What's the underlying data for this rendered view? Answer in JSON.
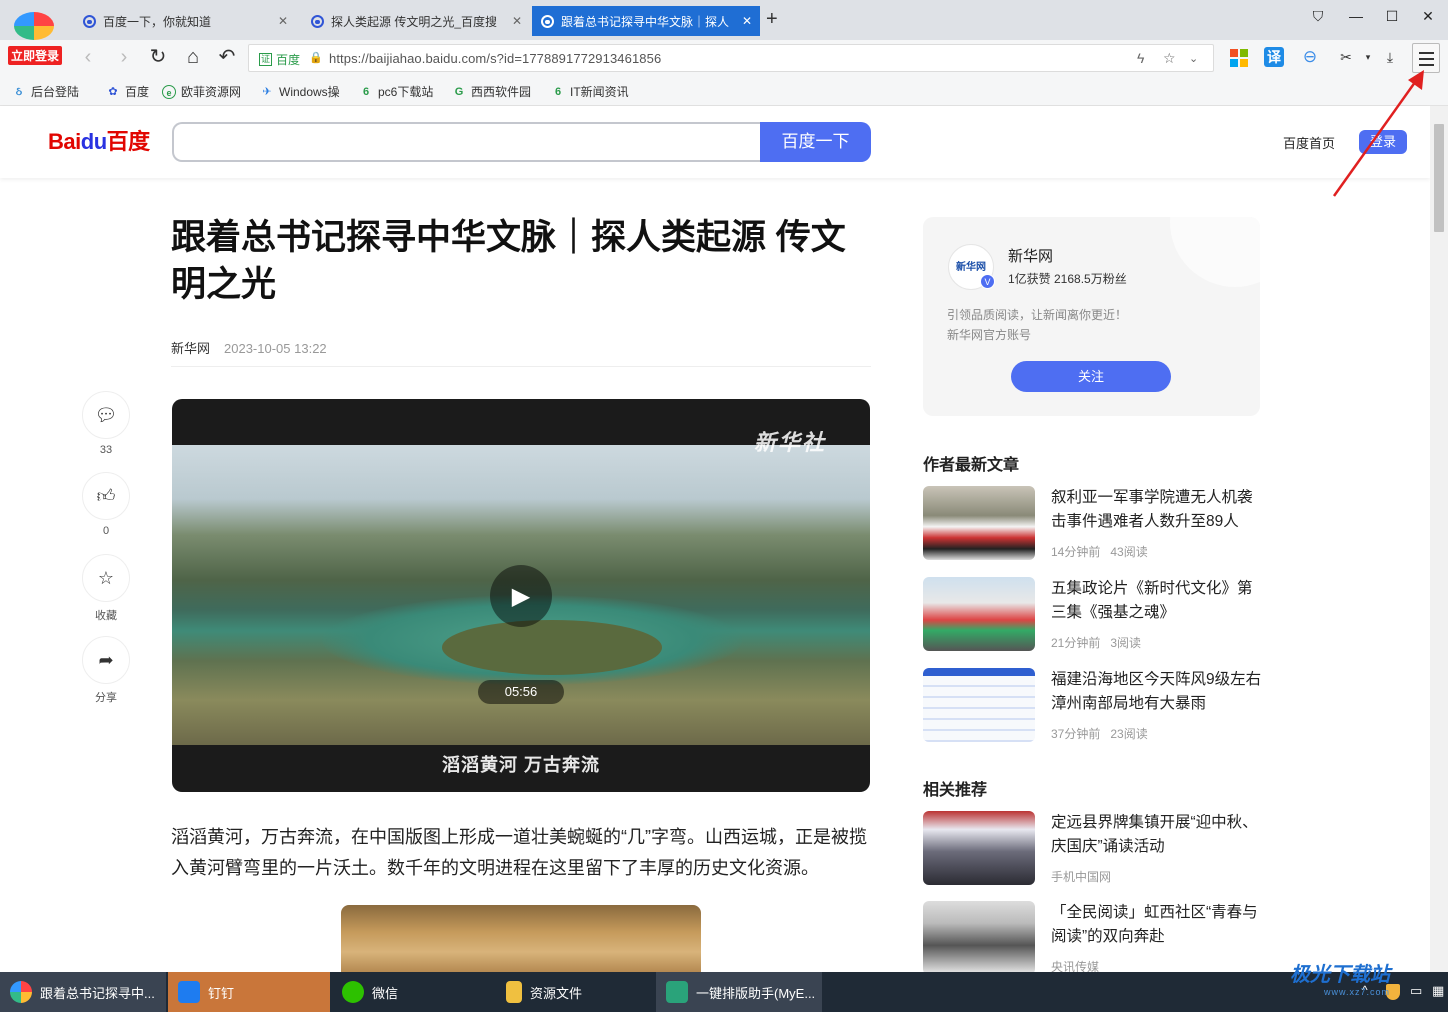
{
  "browser": {
    "profile_badge": "立即登录",
    "tabs": [
      {
        "title": "百度一下，你就知道",
        "active": false
      },
      {
        "title": "探人类起源 传文明之光_百度搜",
        "active": false
      },
      {
        "title": "跟着总书记探寻中华文脉｜探人",
        "active": true
      }
    ],
    "new_tab": "+",
    "address": {
      "secure_label": "百度",
      "url": "https://baijiahao.baidu.com/s?id=1778891772913461856"
    },
    "translate_label": "译",
    "bookmarks": [
      "后台登陆",
      "百度",
      "欧菲资源网",
      "Windows操",
      "pc6下载站",
      "西西软件园",
      "IT新闻资讯"
    ]
  },
  "page_header": {
    "logo_text_1": "Bai",
    "logo_text_2": "du",
    "logo_text_3": "百度",
    "search_button": "百度一下",
    "home_link": "百度首页",
    "login_button": "登录"
  },
  "article": {
    "title": "跟着总书记探寻中华文脉｜探人类起源 传文明之光",
    "source": "新华网",
    "date": "2023-10-05 13:22",
    "side_actions": [
      {
        "icon": "comment-icon",
        "label": "33"
      },
      {
        "icon": "thumbs-up-icon",
        "label": "0"
      },
      {
        "icon": "star-icon",
        "label": "收藏"
      },
      {
        "icon": "share-icon",
        "label": "分享"
      }
    ],
    "video": {
      "watermark": "新华社",
      "duration": "05:56",
      "caption": "滔滔黄河 万古奔流"
    },
    "paragraph": "滔滔黄河，万古奔流，在中国版图上形成一道壮美蜿蜒的“几”字弯。山西运城，正是被揽入黄河臂弯里的一片沃土。数千年的文明进程在这里留下了丰厚的历史文化资源。"
  },
  "author_card": {
    "name": "新华网",
    "stats": "1亿获赞 2168.5万粉丝",
    "desc_1": "引领品质阅读，让新闻离你更近！",
    "desc_2": "新华网官方账号",
    "follow": "关注",
    "avatar_text": "新华网"
  },
  "latest": {
    "heading": "作者最新文章",
    "items": [
      {
        "title": "叙利亚一军事学院遭无人机袭击事件遇难者人数升至89人",
        "time": "14分钟前",
        "reads": "43阅读"
      },
      {
        "title": "五集政论片《新时代文化》第三集《强基之魂》",
        "time": "21分钟前",
        "reads": "3阅读"
      },
      {
        "title": "福建沿海地区今天阵风9级左右 漳州南部局地有大暴雨",
        "time": "37分钟前",
        "reads": "23阅读"
      }
    ]
  },
  "related": {
    "heading": "相关推荐",
    "items": [
      {
        "title": "定远县界牌集镇开展“迎中秋、庆国庆”诵读活动",
        "source": "手机中国网"
      },
      {
        "title": "「全民阅读」虹西社区“青春与阅读”的双向奔赴",
        "source": "央讯传媒"
      }
    ]
  },
  "taskbar": {
    "items": [
      "跟着总书记探寻中...",
      "钉钉",
      "微信",
      "资源文件",
      "一键排版助手(MyE..."
    ]
  },
  "site_watermark": {
    "main": "极光下载站",
    "sub": "www.xz7.com"
  },
  "colors": {
    "accent": "#4e6ef2",
    "tab_active": "#1f6ed4",
    "arrow": "#e02020"
  }
}
